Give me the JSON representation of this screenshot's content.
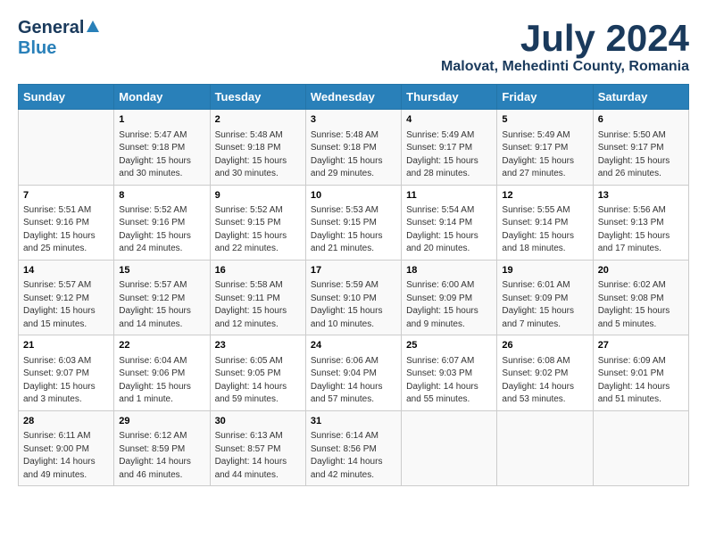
{
  "header": {
    "logo_general": "General",
    "logo_blue": "Blue",
    "month_title": "July 2024",
    "location": "Malovat, Mehedinti County, Romania"
  },
  "days_of_week": [
    "Sunday",
    "Monday",
    "Tuesday",
    "Wednesday",
    "Thursday",
    "Friday",
    "Saturday"
  ],
  "weeks": [
    [
      {
        "day": "",
        "sunrise": "",
        "sunset": "",
        "daylight": ""
      },
      {
        "day": "1",
        "sunrise": "Sunrise: 5:47 AM",
        "sunset": "Sunset: 9:18 PM",
        "daylight": "Daylight: 15 hours and 30 minutes."
      },
      {
        "day": "2",
        "sunrise": "Sunrise: 5:48 AM",
        "sunset": "Sunset: 9:18 PM",
        "daylight": "Daylight: 15 hours and 30 minutes."
      },
      {
        "day": "3",
        "sunrise": "Sunrise: 5:48 AM",
        "sunset": "Sunset: 9:18 PM",
        "daylight": "Daylight: 15 hours and 29 minutes."
      },
      {
        "day": "4",
        "sunrise": "Sunrise: 5:49 AM",
        "sunset": "Sunset: 9:17 PM",
        "daylight": "Daylight: 15 hours and 28 minutes."
      },
      {
        "day": "5",
        "sunrise": "Sunrise: 5:49 AM",
        "sunset": "Sunset: 9:17 PM",
        "daylight": "Daylight: 15 hours and 27 minutes."
      },
      {
        "day": "6",
        "sunrise": "Sunrise: 5:50 AM",
        "sunset": "Sunset: 9:17 PM",
        "daylight": "Daylight: 15 hours and 26 minutes."
      }
    ],
    [
      {
        "day": "7",
        "sunrise": "Sunrise: 5:51 AM",
        "sunset": "Sunset: 9:16 PM",
        "daylight": "Daylight: 15 hours and 25 minutes."
      },
      {
        "day": "8",
        "sunrise": "Sunrise: 5:52 AM",
        "sunset": "Sunset: 9:16 PM",
        "daylight": "Daylight: 15 hours and 24 minutes."
      },
      {
        "day": "9",
        "sunrise": "Sunrise: 5:52 AM",
        "sunset": "Sunset: 9:15 PM",
        "daylight": "Daylight: 15 hours and 22 minutes."
      },
      {
        "day": "10",
        "sunrise": "Sunrise: 5:53 AM",
        "sunset": "Sunset: 9:15 PM",
        "daylight": "Daylight: 15 hours and 21 minutes."
      },
      {
        "day": "11",
        "sunrise": "Sunrise: 5:54 AM",
        "sunset": "Sunset: 9:14 PM",
        "daylight": "Daylight: 15 hours and 20 minutes."
      },
      {
        "day": "12",
        "sunrise": "Sunrise: 5:55 AM",
        "sunset": "Sunset: 9:14 PM",
        "daylight": "Daylight: 15 hours and 18 minutes."
      },
      {
        "day": "13",
        "sunrise": "Sunrise: 5:56 AM",
        "sunset": "Sunset: 9:13 PM",
        "daylight": "Daylight: 15 hours and 17 minutes."
      }
    ],
    [
      {
        "day": "14",
        "sunrise": "Sunrise: 5:57 AM",
        "sunset": "Sunset: 9:12 PM",
        "daylight": "Daylight: 15 hours and 15 minutes."
      },
      {
        "day": "15",
        "sunrise": "Sunrise: 5:57 AM",
        "sunset": "Sunset: 9:12 PM",
        "daylight": "Daylight: 15 hours and 14 minutes."
      },
      {
        "day": "16",
        "sunrise": "Sunrise: 5:58 AM",
        "sunset": "Sunset: 9:11 PM",
        "daylight": "Daylight: 15 hours and 12 minutes."
      },
      {
        "day": "17",
        "sunrise": "Sunrise: 5:59 AM",
        "sunset": "Sunset: 9:10 PM",
        "daylight": "Daylight: 15 hours and 10 minutes."
      },
      {
        "day": "18",
        "sunrise": "Sunrise: 6:00 AM",
        "sunset": "Sunset: 9:09 PM",
        "daylight": "Daylight: 15 hours and 9 minutes."
      },
      {
        "day": "19",
        "sunrise": "Sunrise: 6:01 AM",
        "sunset": "Sunset: 9:09 PM",
        "daylight": "Daylight: 15 hours and 7 minutes."
      },
      {
        "day": "20",
        "sunrise": "Sunrise: 6:02 AM",
        "sunset": "Sunset: 9:08 PM",
        "daylight": "Daylight: 15 hours and 5 minutes."
      }
    ],
    [
      {
        "day": "21",
        "sunrise": "Sunrise: 6:03 AM",
        "sunset": "Sunset: 9:07 PM",
        "daylight": "Daylight: 15 hours and 3 minutes."
      },
      {
        "day": "22",
        "sunrise": "Sunrise: 6:04 AM",
        "sunset": "Sunset: 9:06 PM",
        "daylight": "Daylight: 15 hours and 1 minute."
      },
      {
        "day": "23",
        "sunrise": "Sunrise: 6:05 AM",
        "sunset": "Sunset: 9:05 PM",
        "daylight": "Daylight: 14 hours and 59 minutes."
      },
      {
        "day": "24",
        "sunrise": "Sunrise: 6:06 AM",
        "sunset": "Sunset: 9:04 PM",
        "daylight": "Daylight: 14 hours and 57 minutes."
      },
      {
        "day": "25",
        "sunrise": "Sunrise: 6:07 AM",
        "sunset": "Sunset: 9:03 PM",
        "daylight": "Daylight: 14 hours and 55 minutes."
      },
      {
        "day": "26",
        "sunrise": "Sunrise: 6:08 AM",
        "sunset": "Sunset: 9:02 PM",
        "daylight": "Daylight: 14 hours and 53 minutes."
      },
      {
        "day": "27",
        "sunrise": "Sunrise: 6:09 AM",
        "sunset": "Sunset: 9:01 PM",
        "daylight": "Daylight: 14 hours and 51 minutes."
      }
    ],
    [
      {
        "day": "28",
        "sunrise": "Sunrise: 6:11 AM",
        "sunset": "Sunset: 9:00 PM",
        "daylight": "Daylight: 14 hours and 49 minutes."
      },
      {
        "day": "29",
        "sunrise": "Sunrise: 6:12 AM",
        "sunset": "Sunset: 8:59 PM",
        "daylight": "Daylight: 14 hours and 46 minutes."
      },
      {
        "day": "30",
        "sunrise": "Sunrise: 6:13 AM",
        "sunset": "Sunset: 8:57 PM",
        "daylight": "Daylight: 14 hours and 44 minutes."
      },
      {
        "day": "31",
        "sunrise": "Sunrise: 6:14 AM",
        "sunset": "Sunset: 8:56 PM",
        "daylight": "Daylight: 14 hours and 42 minutes."
      },
      {
        "day": "",
        "sunrise": "",
        "sunset": "",
        "daylight": ""
      },
      {
        "day": "",
        "sunrise": "",
        "sunset": "",
        "daylight": ""
      },
      {
        "day": "",
        "sunrise": "",
        "sunset": "",
        "daylight": ""
      }
    ]
  ]
}
